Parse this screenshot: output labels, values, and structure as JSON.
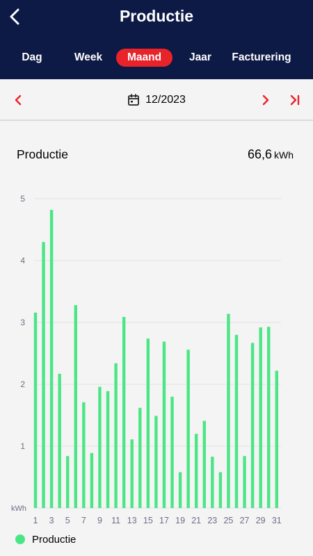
{
  "header": {
    "title": "Productie",
    "tabs": [
      {
        "label": "Dag",
        "active": false
      },
      {
        "label": "Week",
        "active": false
      },
      {
        "label": "Maand",
        "active": true
      },
      {
        "label": "Jaar",
        "active": false
      },
      {
        "label": "Facturering",
        "active": false
      }
    ]
  },
  "date_nav": {
    "date": "12/2023"
  },
  "summary": {
    "label": "Productie",
    "value": "66,6",
    "unit": "kWh"
  },
  "legend": {
    "label": "Productie"
  },
  "colors": {
    "header_bg": "#0e1a46",
    "accent": "#e8232a",
    "bar": "#4ae685"
  },
  "chart_data": {
    "type": "bar",
    "title": "",
    "xlabel": "",
    "ylabel": "kWh",
    "ylim": [
      0,
      5
    ],
    "yticks": [
      1,
      2,
      3,
      4,
      5
    ],
    "grid": true,
    "legend_position": "bottom-left",
    "categories": [
      "1",
      "2",
      "3",
      "4",
      "5",
      "6",
      "7",
      "8",
      "9",
      "10",
      "11",
      "12",
      "13",
      "14",
      "15",
      "16",
      "17",
      "18",
      "19",
      "20",
      "21",
      "22",
      "23",
      "24",
      "25",
      "26",
      "27",
      "28",
      "29",
      "30",
      "31"
    ],
    "xtick_labels": [
      "1",
      "3",
      "5",
      "7",
      "9",
      "11",
      "13",
      "15",
      "17",
      "19",
      "21",
      "23",
      "25",
      "27",
      "29",
      "31"
    ],
    "series": [
      {
        "name": "Productie",
        "values": [
          3.16,
          4.3,
          4.82,
          2.17,
          0.84,
          3.28,
          1.71,
          0.89,
          1.96,
          1.89,
          2.34,
          3.09,
          1.11,
          1.62,
          2.74,
          1.49,
          2.69,
          1.8,
          0.58,
          2.56,
          1.2,
          1.41,
          0.83,
          0.58,
          3.14,
          2.8,
          0.84,
          2.67,
          2.92,
          2.93,
          2.22
        ]
      }
    ]
  }
}
